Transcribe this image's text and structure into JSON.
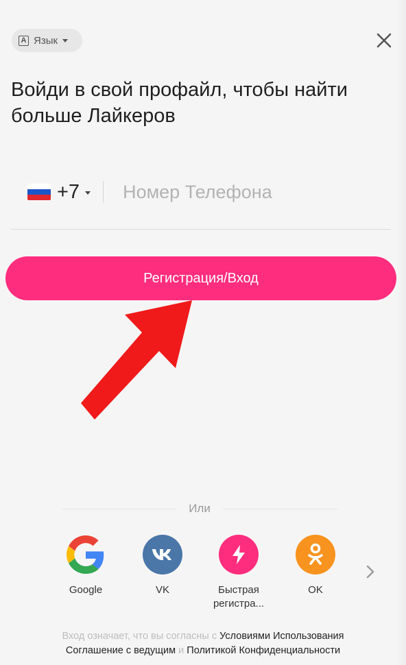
{
  "language": {
    "label": "Язык",
    "icon": "language-icon"
  },
  "close": {
    "icon": "close-icon"
  },
  "title": "Войди в свой профайл, чтобы найти больше Лайкеров",
  "phone": {
    "country_code": "+7",
    "flag": "russia-flag-icon",
    "placeholder": "Номер Телефона",
    "value": ""
  },
  "login_button": {
    "label": "Регистрация/Вход",
    "color": "#ff2d7e"
  },
  "divider_text": "Или",
  "social": [
    {
      "label": "Google",
      "icon": "google-icon",
      "color": "#ffffff"
    },
    {
      "label": "VK",
      "icon": "vk-icon",
      "color": "#4a76a8"
    },
    {
      "label": "Быстрая регистра...",
      "icon": "lightning-icon",
      "color": "#ff2d7e"
    },
    {
      "label": "OK",
      "icon": "odnoklassniki-icon",
      "color": "#f7931e"
    }
  ],
  "legal": {
    "prefix": "Вход означает, что вы согласны с",
    "terms": "Условиями Использования",
    "agreement": "Соглашение с ведущим",
    "and": "и",
    "privacy": "Политикой Конфиденциальности"
  },
  "colors": {
    "accent": "#ff2d7e",
    "arrow": "#f01a1a",
    "background": "#f6f5f5"
  }
}
